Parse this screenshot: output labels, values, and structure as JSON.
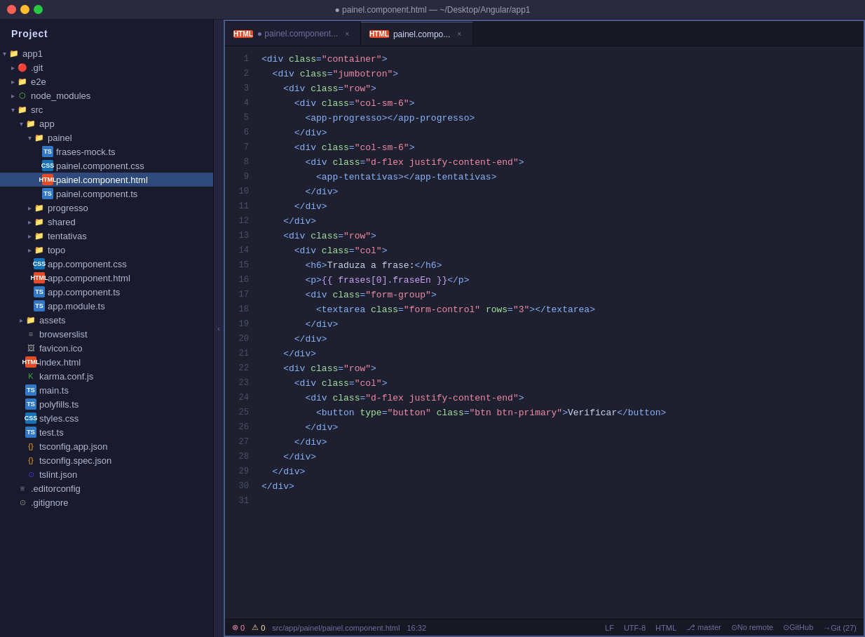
{
  "titlebar": {
    "title": "● painel.component.html — ~/Desktop/Angular/app1"
  },
  "sidebar": {
    "title": "Project",
    "items": [
      {
        "id": "app1",
        "label": "app1",
        "indent": 0,
        "arrow": "open",
        "type": "folder-root"
      },
      {
        "id": "git",
        "label": ".git",
        "indent": 1,
        "arrow": "closed",
        "type": "git"
      },
      {
        "id": "e2e",
        "label": "e2e",
        "indent": 1,
        "arrow": "closed",
        "type": "folder"
      },
      {
        "id": "node_modules",
        "label": "node_modules",
        "indent": 1,
        "arrow": "closed",
        "type": "node"
      },
      {
        "id": "src",
        "label": "src",
        "indent": 1,
        "arrow": "open",
        "type": "folder"
      },
      {
        "id": "app",
        "label": "app",
        "indent": 2,
        "arrow": "open",
        "type": "folder"
      },
      {
        "id": "painel",
        "label": "painel",
        "indent": 3,
        "arrow": "open",
        "type": "folder"
      },
      {
        "id": "frases-mock.ts",
        "label": "frases-mock.ts",
        "indent": 4,
        "arrow": "",
        "type": "ts"
      },
      {
        "id": "painel.component.css",
        "label": "painel.component.css",
        "indent": 4,
        "arrow": "",
        "type": "css"
      },
      {
        "id": "painel.component.html",
        "label": "painel.component.html",
        "indent": 4,
        "arrow": "",
        "type": "html",
        "active": true
      },
      {
        "id": "painel.component.ts",
        "label": "painel.component.ts",
        "indent": 4,
        "arrow": "",
        "type": "ts"
      },
      {
        "id": "progresso",
        "label": "progresso",
        "indent": 3,
        "arrow": "closed",
        "type": "folder"
      },
      {
        "id": "shared",
        "label": "shared",
        "indent": 3,
        "arrow": "closed",
        "type": "folder"
      },
      {
        "id": "tentativas",
        "label": "tentativas",
        "indent": 3,
        "arrow": "closed",
        "type": "folder"
      },
      {
        "id": "topo",
        "label": "topo",
        "indent": 3,
        "arrow": "closed",
        "type": "folder"
      },
      {
        "id": "app.component.css",
        "label": "app.component.css",
        "indent": 3,
        "arrow": "",
        "type": "css"
      },
      {
        "id": "app.component.html",
        "label": "app.component.html",
        "indent": 3,
        "arrow": "",
        "type": "html"
      },
      {
        "id": "app.component.ts",
        "label": "app.component.ts",
        "indent": 3,
        "arrow": "",
        "type": "ts"
      },
      {
        "id": "app.module.ts",
        "label": "app.module.ts",
        "indent": 3,
        "arrow": "",
        "type": "ts"
      },
      {
        "id": "assets",
        "label": "assets",
        "indent": 2,
        "arrow": "closed",
        "type": "folder"
      },
      {
        "id": "browserslist",
        "label": "browserslist",
        "indent": 2,
        "arrow": "",
        "type": "browserslist"
      },
      {
        "id": "favicon.ico",
        "label": "favicon.ico",
        "indent": 2,
        "arrow": "",
        "type": "ico"
      },
      {
        "id": "index.html",
        "label": "index.html",
        "indent": 2,
        "arrow": "",
        "type": "html"
      },
      {
        "id": "karma.conf.js",
        "label": "karma.conf.js",
        "indent": 2,
        "arrow": "",
        "type": "karma"
      },
      {
        "id": "main.ts",
        "label": "main.ts",
        "indent": 2,
        "arrow": "",
        "type": "ts"
      },
      {
        "id": "polyfills.ts",
        "label": "polyfills.ts",
        "indent": 2,
        "arrow": "",
        "type": "ts"
      },
      {
        "id": "styles.css",
        "label": "styles.css",
        "indent": 2,
        "arrow": "",
        "type": "css"
      },
      {
        "id": "test.ts",
        "label": "test.ts",
        "indent": 2,
        "arrow": "",
        "type": "ts"
      },
      {
        "id": "tsconfig.app.json",
        "label": "tsconfig.app.json",
        "indent": 2,
        "arrow": "",
        "type": "json"
      },
      {
        "id": "tsconfig.spec.json",
        "label": "tsconfig.spec.json",
        "indent": 2,
        "arrow": "",
        "type": "json"
      },
      {
        "id": "tslint.json",
        "label": "tslint.json",
        "indent": 2,
        "arrow": "",
        "type": "eslint"
      },
      {
        "id": ".editorconfig",
        "label": ".editorconfig",
        "indent": 1,
        "arrow": "",
        "type": "editorconfig"
      },
      {
        "id": ".gitignore",
        "label": ".gitignore",
        "indent": 1,
        "arrow": "",
        "type": "gitignore"
      }
    ]
  },
  "tabs": [
    {
      "id": "tab1",
      "label": "painel.component...",
      "icon": "html",
      "active": false,
      "dot": true
    },
    {
      "id": "tab2",
      "label": "painel.compo...",
      "icon": "html",
      "active": true,
      "dot": false
    }
  ],
  "editor": {
    "lines": [
      {
        "num": 1,
        "code": "<div class=\"container\">"
      },
      {
        "num": 2,
        "code": "  <div class=\"jumbotron\">"
      },
      {
        "num": 3,
        "code": "    <div class=\"row\">"
      },
      {
        "num": 4,
        "code": "      <div class=\"col-sm-6\">"
      },
      {
        "num": 5,
        "code": "        <app-progresso></app-progresso>"
      },
      {
        "num": 6,
        "code": "      </div>"
      },
      {
        "num": 7,
        "code": "      <div class=\"col-sm-6\">"
      },
      {
        "num": 8,
        "code": "        <div class=\"d-flex justify-content-end\">"
      },
      {
        "num": 9,
        "code": "          <app-tentativas></app-tentativas>"
      },
      {
        "num": 10,
        "code": "        </div>"
      },
      {
        "num": 11,
        "code": "      </div>"
      },
      {
        "num": 12,
        "code": "    </div>"
      },
      {
        "num": 13,
        "code": "    <div class=\"row\">"
      },
      {
        "num": 14,
        "code": "      <div class=\"col\">"
      },
      {
        "num": 15,
        "code": "        <h6>Traduza a frase:</h6>"
      },
      {
        "num": 16,
        "code": "        <p>{{ frases[0].fraseEn }}</p>"
      },
      {
        "num": 17,
        "code": "        <div class=\"form-group\">"
      },
      {
        "num": 18,
        "code": "          <textarea class=\"form-control\" rows=\"3\"></textarea>"
      },
      {
        "num": 19,
        "code": "        </div>"
      },
      {
        "num": 20,
        "code": "      </div>"
      },
      {
        "num": 21,
        "code": "    </div>"
      },
      {
        "num": 22,
        "code": "    <div class=\"row\">"
      },
      {
        "num": 23,
        "code": "      <div class=\"col\">"
      },
      {
        "num": 24,
        "code": "        <div class=\"d-flex justify-content-end\">"
      },
      {
        "num": 25,
        "code": "          <button type=\"button\" class=\"btn btn-primary\">Verificar</button>"
      },
      {
        "num": 26,
        "code": "        </div>"
      },
      {
        "num": 27,
        "code": "      </div>"
      },
      {
        "num": 28,
        "code": "    </div>"
      },
      {
        "num": 29,
        "code": "  </div>"
      },
      {
        "num": 30,
        "code": "</div>"
      },
      {
        "num": 31,
        "code": ""
      }
    ]
  },
  "statusbar": {
    "errors": "0",
    "warnings": "0",
    "path": "src/app/painel/painel.component.html",
    "time": "16:32",
    "encoding": "LF",
    "charset": "UTF-8",
    "language": "HTML",
    "branch": "⎇ master",
    "remote": "⊙No remote",
    "github": "⊙GitHub",
    "git": "→Git (27)"
  }
}
